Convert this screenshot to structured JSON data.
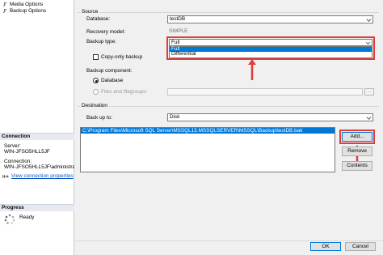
{
  "left_pane": {
    "pages": [
      {
        "label": "Media Options",
        "icon": "page-wrench-icon"
      },
      {
        "label": "Backup Options",
        "icon": "page-wrench-icon"
      }
    ],
    "connection": {
      "header": "Connection",
      "server_label": "Server:",
      "server_value": "WIN-JFSO5HLL5JF",
      "connection_label": "Connection:",
      "connection_value": "WIN-JFSO5HLL5JF\\administrator",
      "view_link": "View connection properties"
    },
    "progress": {
      "header": "Progress",
      "status": "Ready"
    }
  },
  "source": {
    "group_title": "Source",
    "database_label": "Database:",
    "database_value": "testDB",
    "recovery_label": "Recovery model:",
    "recovery_value": "SIMPLE",
    "backup_type_label": "Backup type:",
    "backup_type_value": "Full",
    "backup_type_options": [
      "Full",
      "Differential"
    ],
    "copy_only_label": "Copy-only backup",
    "copy_only_checked": false,
    "component_label": "Backup component:",
    "component_options": [
      "Database",
      "Files and filegroups:"
    ],
    "component_selected": "Database"
  },
  "destination": {
    "group_title": "Destination",
    "back_up_to_label": "Back up to:",
    "back_up_to_value": "Disk",
    "paths": [
      "C:\\Program Files\\Microsoft SQL Server\\MSSQL15.MSSQLSERVER\\MSSQL\\Backup\\testDB.bak"
    ],
    "add_button": "Add...",
    "remove_button": "Remove",
    "contents_button": "Contents"
  },
  "footer": {
    "ok_button": "OK",
    "cancel_button": "Cancel"
  },
  "colors": {
    "annotation_red": "#e23b3b",
    "selection_blue": "#0078d7",
    "link_blue": "#0b58c4"
  }
}
